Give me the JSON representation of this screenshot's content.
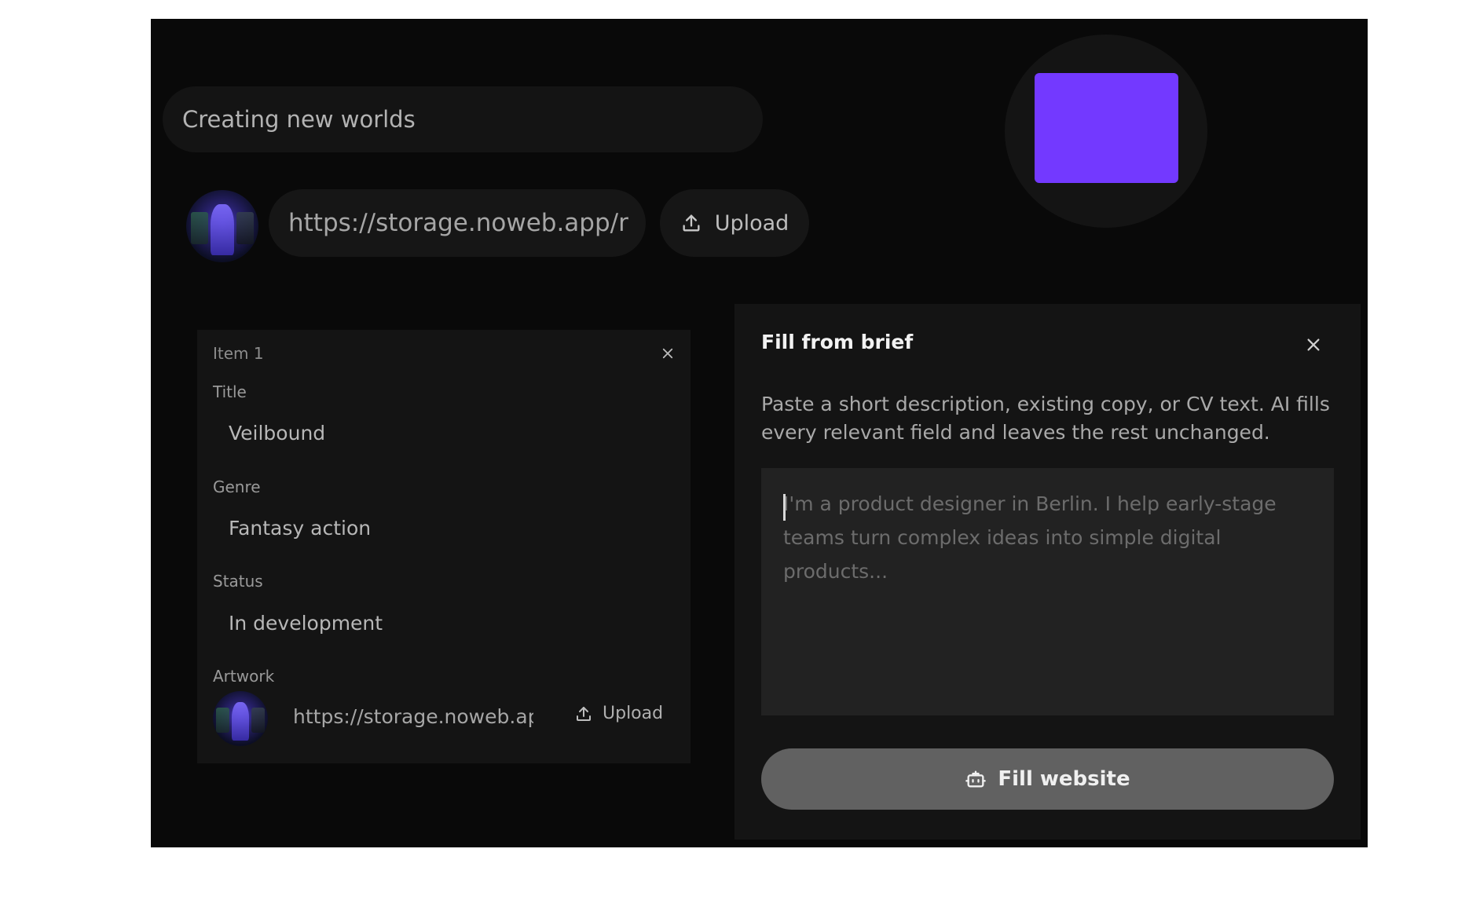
{
  "header": {
    "tagline": "Creating new worlds",
    "cover_url": "https://storage.noweb.app/r",
    "upload_label": "Upload",
    "brand_color": "#7339ff"
  },
  "item": {
    "heading": "Item 1",
    "fields": [
      {
        "label": "Title",
        "value": "Veilbound"
      },
      {
        "label": "Genre",
        "value": "Fantasy action"
      },
      {
        "label": "Status",
        "value": "In development"
      }
    ],
    "artwork": {
      "label": "Artwork",
      "url": "https://storage.noweb.ap",
      "upload_label": "Upload"
    }
  },
  "brief": {
    "title": "Fill from brief",
    "description": "Paste a short description, existing copy, or CV text. AI fills every relevant field and leaves the rest unchanged.",
    "placeholder": "I'm a product designer in Berlin. I help early-stage teams turn complex ideas into simple digital products...",
    "button_label": "Fill website",
    "button_icon": "robot-icon"
  },
  "icons": {
    "upload": "upload-icon",
    "close": "close-icon"
  }
}
